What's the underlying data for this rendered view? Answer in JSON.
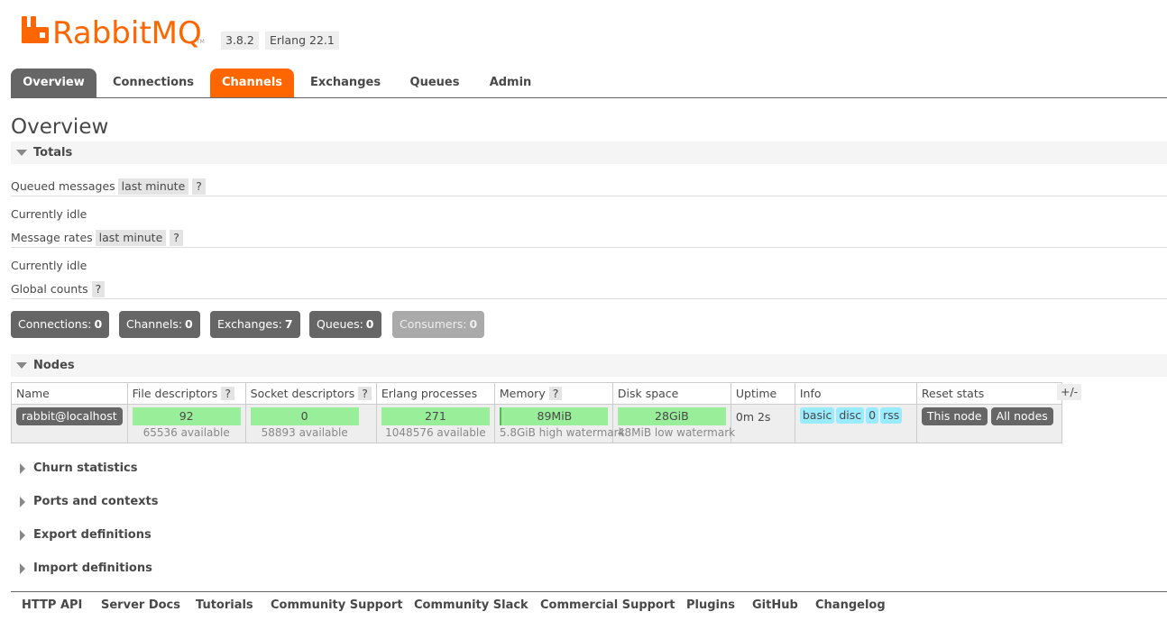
{
  "header": {
    "logo_text": "RabbitMQ",
    "logo_tm": "TM",
    "version": "3.8.2",
    "erlang": "Erlang 22.1",
    "brand_color": "#ff6600"
  },
  "nav": {
    "tabs": [
      {
        "label": "Overview",
        "state": "active"
      },
      {
        "label": "Connections",
        "state": "normal"
      },
      {
        "label": "Channels",
        "state": "hover"
      },
      {
        "label": "Exchanges",
        "state": "normal"
      },
      {
        "label": "Queues",
        "state": "normal"
      },
      {
        "label": "Admin",
        "state": "normal"
      }
    ]
  },
  "page_title": "Overview",
  "totals": {
    "heading": "Totals",
    "queued_messages": {
      "label": "Queued messages",
      "option": "last minute",
      "help": "?"
    },
    "queued_status": "Currently idle",
    "message_rates": {
      "label": "Message rates",
      "option": "last minute",
      "help": "?"
    },
    "rates_status": "Currently idle",
    "global_counts": {
      "label": "Global counts",
      "help": "?"
    },
    "counts": [
      {
        "label": "Connections:",
        "value": "0"
      },
      {
        "label": "Channels:",
        "value": "0"
      },
      {
        "label": "Exchanges:",
        "value": "7"
      },
      {
        "label": "Queues:",
        "value": "0"
      },
      {
        "label": "Consumers:",
        "value": "0"
      }
    ]
  },
  "nodes": {
    "heading": "Nodes",
    "columns": {
      "name": "Name",
      "file_descriptors": "File descriptors",
      "socket_descriptors": "Socket descriptors",
      "erlang_processes": "Erlang processes",
      "memory": "Memory",
      "disk_space": "Disk space",
      "uptime": "Uptime",
      "info": "Info",
      "reset_stats": "Reset stats",
      "help": "?"
    },
    "toggle_columns": "+/-",
    "row": {
      "name": "rabbit@localhost",
      "file_descriptors": "92",
      "file_descriptors_available": "65536 available",
      "socket_descriptors": "0",
      "socket_descriptors_available": "58893 available",
      "erlang_processes": "271",
      "erlang_processes_available": "1048576 available",
      "memory": "89MiB",
      "memory_watermark": "5.8GiB high watermark",
      "disk_space": "28GiB",
      "disk_watermark": "48MiB low watermark",
      "uptime": "0m 2s",
      "info_tags": [
        "basic",
        "disc",
        "0",
        "rss"
      ],
      "reset_this_node": "This node",
      "reset_all_nodes": "All nodes"
    }
  },
  "sections": [
    {
      "label": "Churn statistics"
    },
    {
      "label": "Ports and contexts"
    },
    {
      "label": "Export definitions"
    },
    {
      "label": "Import definitions"
    }
  ],
  "footer": {
    "links": [
      "HTTP API",
      "Server Docs",
      "Tutorials",
      "Community Support",
      "Community Slack",
      "Commercial Support",
      "Plugins",
      "GitHub",
      "Changelog"
    ]
  }
}
